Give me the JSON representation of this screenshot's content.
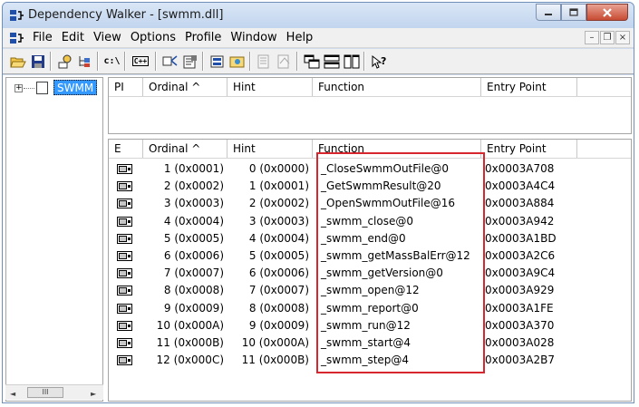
{
  "window": {
    "title": "Dependency Walker - [swmm.dll]",
    "buttons": {
      "minimize": "minimize",
      "maximize": "maximize",
      "close": "close"
    }
  },
  "menubar": {
    "items": [
      "File",
      "Edit",
      "View",
      "Options",
      "Profile",
      "Window",
      "Help"
    ],
    "mdi": {
      "minimize": "–",
      "restore": "❐",
      "close": "×"
    }
  },
  "toolbar": {
    "items": [
      {
        "name": "open-icon"
      },
      {
        "name": "save-icon"
      },
      {
        "name": "find-icon"
      },
      {
        "name": "copy-icon"
      },
      {
        "name": "full-paths-button",
        "text": "c:\\"
      },
      {
        "name": "undecorate-cpp-button",
        "text": "C++"
      },
      {
        "name": "autoexpand-icon"
      },
      {
        "name": "properties-icon"
      },
      {
        "name": "view-module-icon"
      },
      {
        "name": "explore-icon"
      },
      {
        "name": "external-viewer-icon"
      },
      {
        "name": "system-info-icon"
      },
      {
        "name": "cascade-icon"
      },
      {
        "name": "tile-horizontal-icon"
      },
      {
        "name": "tile-vertical-icon"
      },
      {
        "name": "help-icon"
      }
    ]
  },
  "tree": {
    "expander": "+",
    "module_label": "SWMM",
    "scroll": {
      "left": "◄",
      "thumb": "III",
      "right": "►"
    }
  },
  "imports_pane": {
    "columns": [
      "PI",
      "Ordinal ^",
      "Hint",
      "Function",
      "Entry Point"
    ]
  },
  "exports_pane": {
    "columns": [
      "E",
      "Ordinal ^",
      "Hint",
      "Function",
      "Entry Point"
    ],
    "rows": [
      {
        "ordinal": "1 (0x0001)",
        "hint": "0 (0x0000)",
        "function": "_CloseSwmmOutFile@0",
        "entry": "0x0003A708"
      },
      {
        "ordinal": "2 (0x0002)",
        "hint": "1 (0x0001)",
        "function": "_GetSwmmResult@20",
        "entry": "0x0003A4C4"
      },
      {
        "ordinal": "3 (0x0003)",
        "hint": "2 (0x0002)",
        "function": "_OpenSwmmOutFile@16",
        "entry": "0x0003A884"
      },
      {
        "ordinal": "4 (0x0004)",
        "hint": "3 (0x0003)",
        "function": "_swmm_close@0",
        "entry": "0x0003A942"
      },
      {
        "ordinal": "5 (0x0005)",
        "hint": "4 (0x0004)",
        "function": "_swmm_end@0",
        "entry": "0x0003A1BD"
      },
      {
        "ordinal": "6 (0x0006)",
        "hint": "5 (0x0005)",
        "function": "_swmm_getMassBalErr@12",
        "entry": "0x0003A2C6"
      },
      {
        "ordinal": "7 (0x0007)",
        "hint": "6 (0x0006)",
        "function": "_swmm_getVersion@0",
        "entry": "0x0003A9C4"
      },
      {
        "ordinal": "8 (0x0008)",
        "hint": "7 (0x0007)",
        "function": "_swmm_open@12",
        "entry": "0x0003A929"
      },
      {
        "ordinal": "9 (0x0009)",
        "hint": "8 (0x0008)",
        "function": "_swmm_report@0",
        "entry": "0x0003A1FE"
      },
      {
        "ordinal": "10 (0x000A)",
        "hint": "9 (0x0009)",
        "function": "_swmm_run@12",
        "entry": "0x0003A370"
      },
      {
        "ordinal": "11 (0x000B)",
        "hint": "10 (0x000A)",
        "function": "_swmm_start@4",
        "entry": "0x0003A028"
      },
      {
        "ordinal": "12 (0x000C)",
        "hint": "11 (0x000B)",
        "function": "_swmm_step@4",
        "entry": "0x0003A2B7"
      }
    ]
  },
  "colors": {
    "selection": "#3399ff",
    "highlight_box": "#d7262e",
    "titlebar": "#c2d5ee"
  }
}
